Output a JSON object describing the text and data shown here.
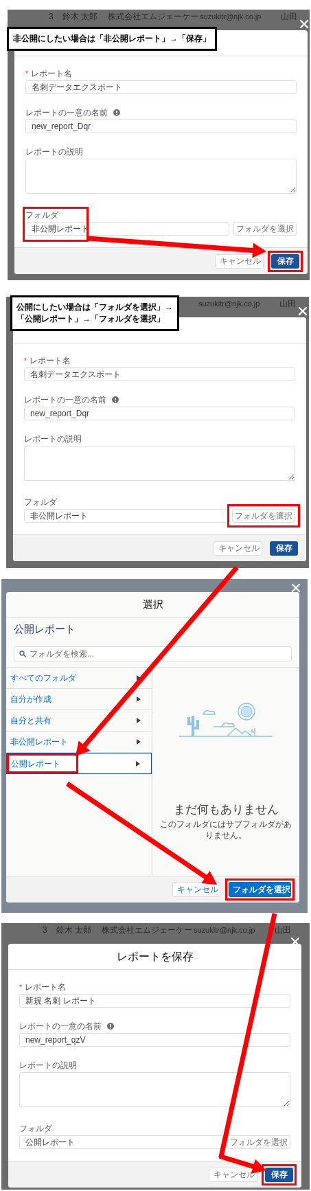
{
  "panels": [
    {
      "kind": "save_dialog",
      "background_row": [
        "3",
        "鈴木 太郎",
        "株式会社エムジェーケー",
        "suzukitr@njk.co.jp",
        "山田"
      ],
      "callout": [
        "非公開にしたい場合は「非公開レポート」→「保存」"
      ],
      "fields": [
        {
          "kind": "input",
          "mark": "*",
          "label": "レポート名",
          "value": "名刺データエクスポート"
        },
        {
          "kind": "input",
          "label": "レポートの一意の名前",
          "info": true,
          "value": "new_report_Dqr"
        },
        {
          "kind": "textarea",
          "label": "レポートの説明"
        },
        {
          "kind": "folder",
          "label": "フォルダ",
          "value": "非公開レポート",
          "button": "フォルダを選択",
          "highlighted": true,
          "button_highlighted": false
        }
      ],
      "buttons": [
        {
          "kind": "neutral",
          "label": "キャンセル",
          "highlighted": false
        },
        {
          "kind": "brand",
          "label": "保存",
          "highlighted": true
        }
      ]
    },
    {
      "kind": "save_dialog",
      "background_row": [
        "suzukitr@njk.co.jp",
        "山田"
      ],
      "callout": [
        "公開にしたい場合は「フォルダを選択」→",
        "「公開レポート」→「フォルダを選択」"
      ],
      "fields": [
        {
          "kind": "input",
          "mark": "*",
          "label": "レポート名",
          "value": "名刺データエクスポート"
        },
        {
          "kind": "input",
          "label": "レポートの一意の名前",
          "info": true,
          "value": "new_report_Dqr"
        },
        {
          "kind": "textarea",
          "label": "レポートの説明"
        },
        {
          "kind": "folder",
          "label": "フォルダ",
          "value": "非公開レポート",
          "button": "フォルダを選択",
          "highlighted": false,
          "button_highlighted": true
        }
      ],
      "buttons": [
        {
          "kind": "neutral",
          "label": "キャンセル",
          "highlighted": false
        },
        {
          "kind": "brand",
          "label": "保存",
          "highlighted": false
        }
      ]
    },
    {
      "kind": "folder_picker",
      "title": "選択",
      "current": "公開レポート",
      "search_placeholder": "フォルダを検索...",
      "items": [
        {
          "label": "すべてのフォルダ",
          "selected": false,
          "highlighted": false
        },
        {
          "label": "自分が作成",
          "selected": false,
          "highlighted": false
        },
        {
          "label": "自分と共有",
          "selected": false,
          "highlighted": false
        },
        {
          "label": "非公開レポート",
          "selected": false,
          "highlighted": false
        },
        {
          "label": "公開レポート",
          "selected": true,
          "highlighted": true
        }
      ],
      "empty_title": "まだ何もありません",
      "empty_message": "このフォルダにはサブフォルダがありません。",
      "buttons": [
        {
          "kind": "neutral",
          "label": "キャンセル",
          "highlighted": false
        },
        {
          "kind": "brand",
          "label": "フォルダを選択",
          "highlighted": true
        }
      ]
    },
    {
      "kind": "save_dialog",
      "background_row": [
        "3",
        "鈴木 太郎",
        "株式会社エムジェーケー",
        "suzukitr@njk.co.jp",
        "山田"
      ],
      "title": "レポートを保存",
      "fields": [
        {
          "kind": "input",
          "mark": "*",
          "label": "レポート名",
          "value": "新規 名刺 レポート"
        },
        {
          "kind": "input",
          "label": "レポートの一意の名前",
          "info": true,
          "value": "new_report_qzV"
        },
        {
          "kind": "textarea",
          "label": "レポートの説明"
        },
        {
          "kind": "folder",
          "label": "フォルダ",
          "value": "公開レポート",
          "button": "フォルダを選択",
          "highlighted": false,
          "button_highlighted": false
        }
      ],
      "buttons": [
        {
          "kind": "neutral",
          "label": "キャンセル",
          "highlighted": false
        },
        {
          "kind": "brand",
          "label": "保存",
          "highlighted": true
        }
      ]
    }
  ]
}
